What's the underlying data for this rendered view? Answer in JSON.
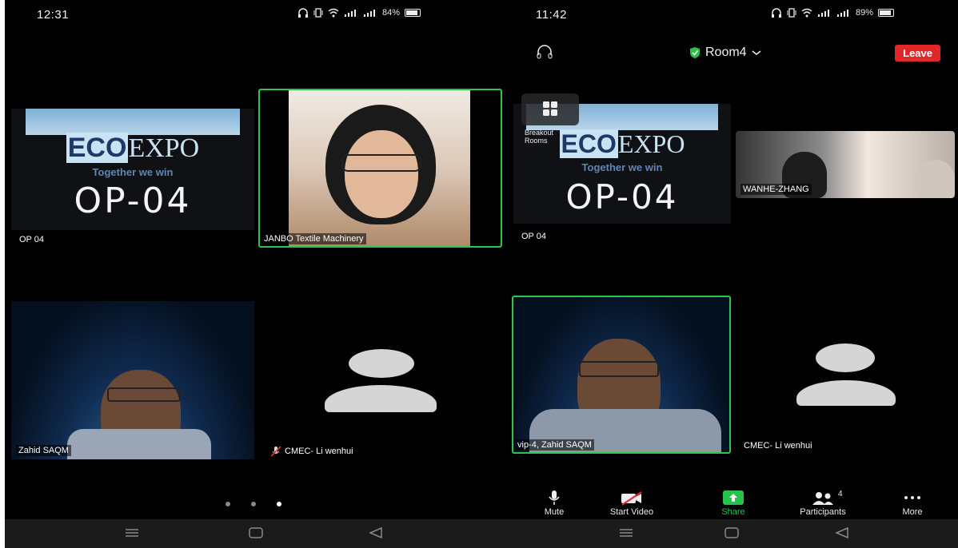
{
  "left": {
    "status": {
      "time": "12:31",
      "battery": "84%"
    },
    "tiles": {
      "expo": {
        "brand_eco": "ECO",
        "brand_expo": "EXPO",
        "tagline": "Together we win",
        "code": "OP-04",
        "name": "OP 04"
      },
      "janbo": {
        "name": "JANBO Textile Machinery"
      },
      "zahid": {
        "name": "Zahid SAQM"
      },
      "cmec": {
        "name": "CMEC- Li wenhui",
        "muted": true
      }
    },
    "page_dots": {
      "count": 3,
      "active_index": 2
    }
  },
  "right": {
    "status": {
      "time": "11:42",
      "battery": "89%"
    },
    "topbar": {
      "room_name": "Room4",
      "leave_label": "Leave"
    },
    "breakout": {
      "label": "Breakout Rooms"
    },
    "tiles": {
      "expo": {
        "brand_eco": "ECO",
        "brand_expo": "EXPO",
        "tagline": "Together we win",
        "code": "OP-04",
        "name": "OP 04"
      },
      "wanhe": {
        "name": "WANHE-ZHANG"
      },
      "zahid": {
        "name": "vip-4, Zahid SAQM"
      },
      "cmec": {
        "name": "CMEC- Li wenhui"
      }
    },
    "toolbar": {
      "mute": "Mute",
      "start_video": "Start Video",
      "share": "Share",
      "participants": "Participants",
      "participants_count": "4",
      "more": "More"
    }
  },
  "colors": {
    "active_border": "#35c24b",
    "leave": "#e02828",
    "share": "#27c24c",
    "shield": "#2fbf4a"
  }
}
